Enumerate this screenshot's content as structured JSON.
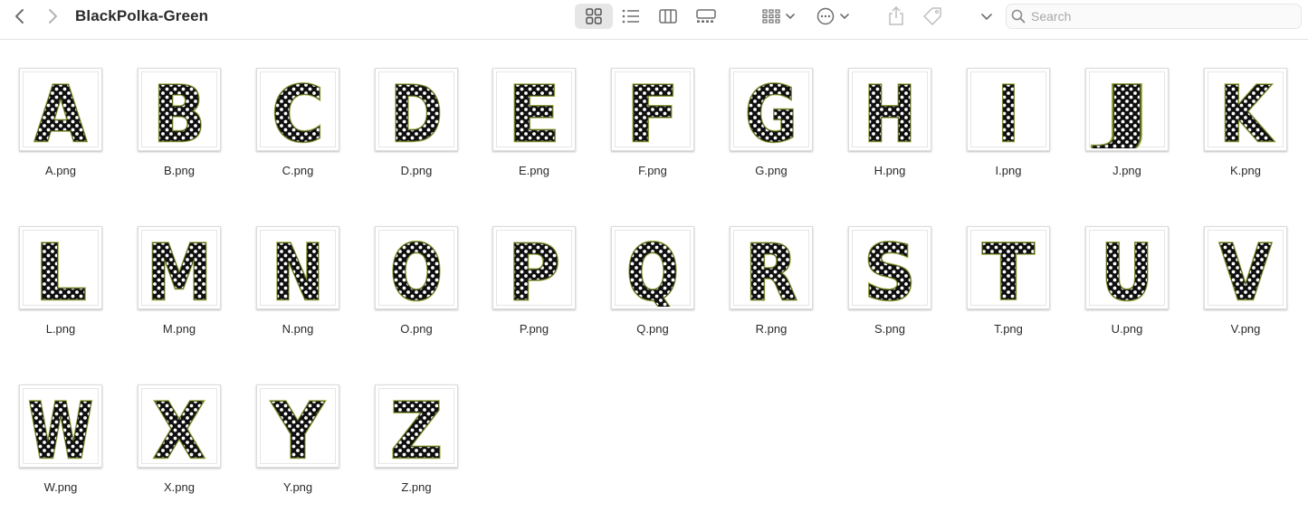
{
  "window": {
    "title": "BlackPolka-Green",
    "search_placeholder": "Search"
  },
  "toolbar": {
    "icons": [
      "chevron-left-icon",
      "chevron-right-icon",
      "grid-view-icon",
      "list-view-icon",
      "column-view-icon",
      "gallery-view-icon",
      "group-icon",
      "action-icon",
      "share-icon",
      "tag-icon",
      "chevron-down-icon",
      "search-icon"
    ],
    "selected_view": "icons"
  },
  "files": [
    {
      "name": "A.png",
      "letter": "A"
    },
    {
      "name": "B.png",
      "letter": "B"
    },
    {
      "name": "C.png",
      "letter": "C"
    },
    {
      "name": "D.png",
      "letter": "D"
    },
    {
      "name": "E.png",
      "letter": "E"
    },
    {
      "name": "F.png",
      "letter": "F"
    },
    {
      "name": "G.png",
      "letter": "G"
    },
    {
      "name": "H.png",
      "letter": "H"
    },
    {
      "name": "I.png",
      "letter": "I"
    },
    {
      "name": "J.png",
      "letter": "J"
    },
    {
      "name": "K.png",
      "letter": "K"
    },
    {
      "name": "L.png",
      "letter": "L"
    },
    {
      "name": "M.png",
      "letter": "M"
    },
    {
      "name": "N.png",
      "letter": "N"
    },
    {
      "name": "O.png",
      "letter": "O"
    },
    {
      "name": "P.png",
      "letter": "P"
    },
    {
      "name": "Q.png",
      "letter": "Q"
    },
    {
      "name": "R.png",
      "letter": "R"
    },
    {
      "name": "S.png",
      "letter": "S"
    },
    {
      "name": "T.png",
      "letter": "T"
    },
    {
      "name": "U.png",
      "letter": "U"
    },
    {
      "name": "V.png",
      "letter": "V"
    },
    {
      "name": "W.png",
      "letter": "W"
    },
    {
      "name": "X.png",
      "letter": "X"
    },
    {
      "name": "Y.png",
      "letter": "Y"
    },
    {
      "name": "Z.png",
      "letter": "Z"
    }
  ],
  "colors": {
    "letter_fill": "#0f0f0f",
    "letter_outline": "#9fb04a",
    "letter_outline_dark": "#3c4412",
    "polka_dot": "#ffffff"
  }
}
